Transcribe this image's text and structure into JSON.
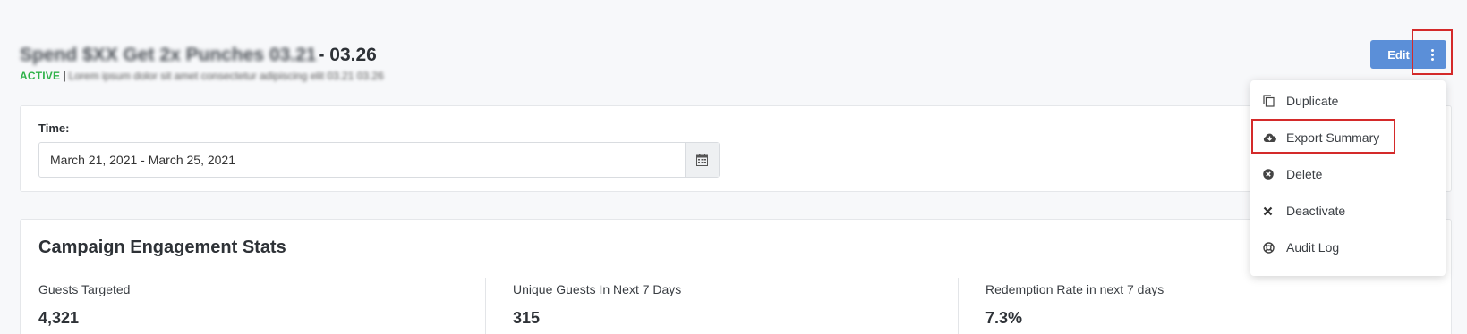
{
  "header": {
    "title_blurred": "Spend $XX Get 2x Punches 03.21",
    "title_tail": " - 03.26",
    "status": "ACTIVE",
    "separator": "|",
    "subtitle_blurred": "Lorem ipsum dolor sit amet consectetur adipiscing elit 03.21 03.26"
  },
  "actions": {
    "edit_label": "Edit",
    "more_icon": "vertical-ellipsis-icon"
  },
  "time_filter": {
    "label": "Time:",
    "value": "March 21, 2021 - March 25, 2021",
    "icon": "calendar-icon"
  },
  "stats": {
    "title": "Campaign Engagement Stats",
    "items": [
      {
        "label": "Guests Targeted",
        "value": "4,321"
      },
      {
        "label": "Unique Guests In Next 7 Days",
        "value": "315"
      },
      {
        "label": "Redemption Rate in next 7 days",
        "value": "7.3%"
      }
    ]
  },
  "menu": {
    "items": [
      {
        "label": "Duplicate",
        "icon": "copy-icon"
      },
      {
        "label": "Export Summary",
        "icon": "cloud-download-icon"
      },
      {
        "label": "Delete",
        "icon": "circle-x-icon"
      },
      {
        "label": "Deactivate",
        "icon": "x-icon"
      },
      {
        "label": "Audit Log",
        "icon": "life-ring-icon"
      }
    ]
  },
  "colors": {
    "primary": "#5b8fd8",
    "active": "#2fb24a",
    "highlight": "#d42a2a"
  }
}
